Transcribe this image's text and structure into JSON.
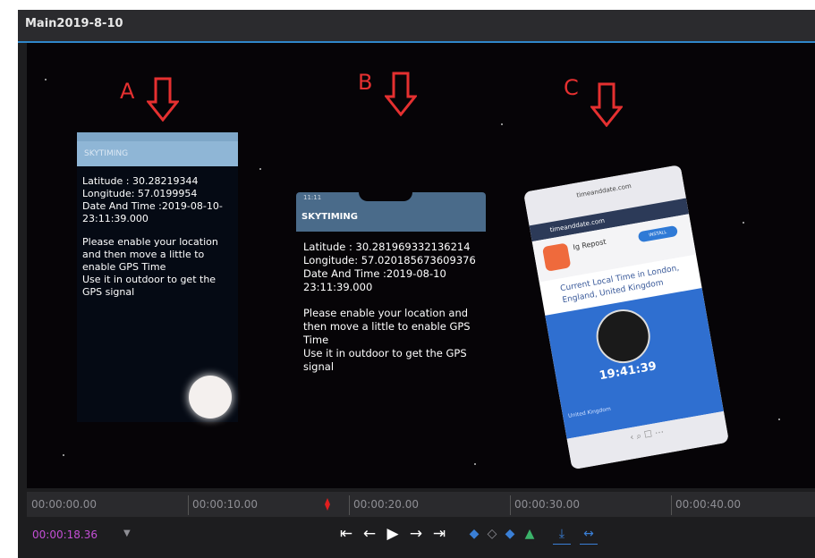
{
  "window": {
    "title": "Main2019-8-10"
  },
  "labels": [
    "A",
    "B",
    "C"
  ],
  "phone_a": {
    "app_name": "SKYTIMING",
    "latitude": "Latitude : 30.28219344",
    "longitude": "Longitude: 57.0199954",
    "datetime": "Date And Time :2019-08-10-23:11:39.000",
    "message": "Please enable your location and then move a little to enable GPS Time",
    "hint": "Use it in outdoor to get the GPS signal"
  },
  "phone_b": {
    "status": "11:11",
    "app_name": "SKYTIMING",
    "latitude": "Latitude : 30.281969332136214",
    "longitude": "Longitude: 57.020185673609376",
    "datetime": "Date And Time :2019-08-10 23:11:39.000",
    "message": "Please enable your location and then move a little to enable GPS Time",
    "hint": "Use it in outdoor to get the GPS signal"
  },
  "phone_c": {
    "url": "timeanddate.com",
    "site": "timeanddate.com",
    "ad_app": "Ig Repost",
    "ad_button": "INSTALL",
    "headline": "Current Local Time in London, England, United Kingdom",
    "time": "19:41:39",
    "country": "United Kingdom"
  },
  "timeline": {
    "timecodes": [
      "00:00:00.00",
      "00:00:10.00",
      "00:00:20.00",
      "00:00:30.00",
      "00:00:40.00"
    ],
    "current": "00:00:18.36",
    "dropdown": "▼"
  },
  "transport": {
    "go_start": "⇤",
    "step_back": "←",
    "play": "▶",
    "step_forward": "→",
    "go_end": "⇥",
    "mark_in": "◆",
    "marker": "◇",
    "mark_out": "◆",
    "add_marker": "▲",
    "export": "⤓",
    "fit": "↔"
  },
  "colors": {
    "accent": "#2f86c9",
    "playhead": "#e01e1e",
    "current_time": "#c54fd6",
    "annotation": "#e53030"
  }
}
